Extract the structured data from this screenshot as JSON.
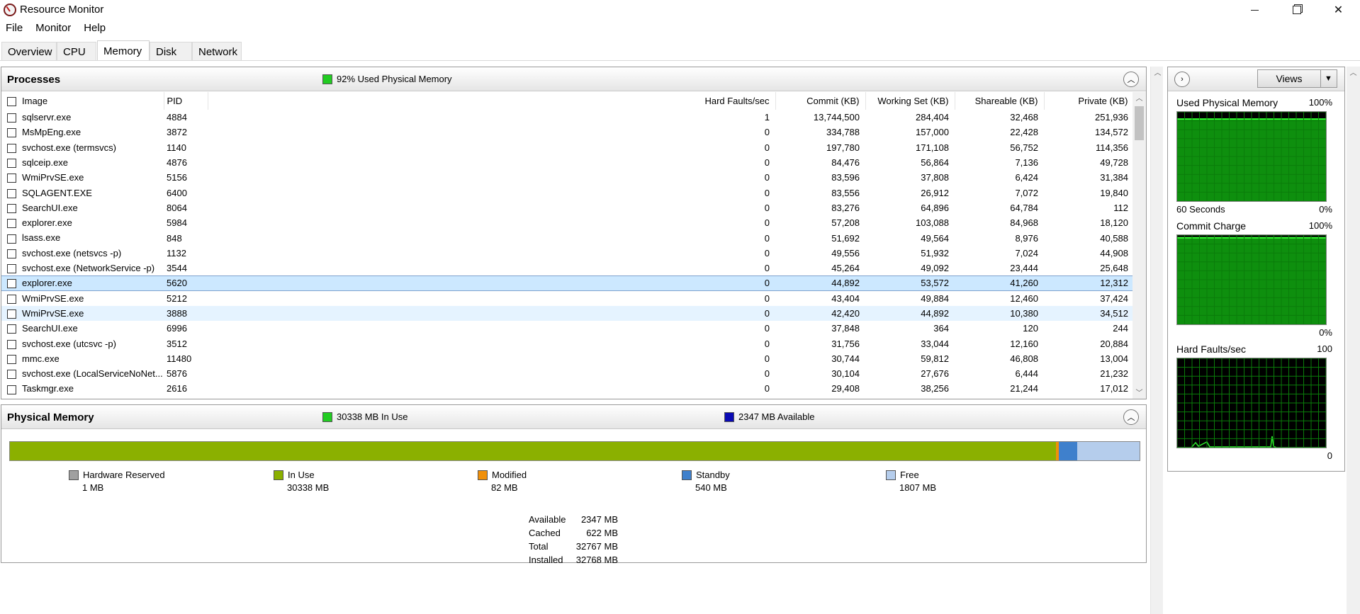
{
  "window": {
    "title": "Resource Monitor"
  },
  "menu": [
    "File",
    "Monitor",
    "Help"
  ],
  "tabs": [
    "Overview",
    "CPU",
    "Memory",
    "Disk",
    "Network"
  ],
  "active_tab": "Memory",
  "processes": {
    "title": "Processes",
    "summary": "92% Used Physical Memory",
    "summary_color": "#22cc22",
    "columns": [
      "Image",
      "PID",
      "Hard Faults/sec",
      "Commit (KB)",
      "Working Set (KB)",
      "Shareable (KB)",
      "Private (KB)"
    ],
    "rows": [
      {
        "image": "sqlservr.exe",
        "pid": "4884",
        "hf": "1",
        "commit": "13,744,500",
        "ws": "284,404",
        "share": "32,468",
        "priv": "251,936"
      },
      {
        "image": "MsMpEng.exe",
        "pid": "3872",
        "hf": "0",
        "commit": "334,788",
        "ws": "157,000",
        "share": "22,428",
        "priv": "134,572"
      },
      {
        "image": "svchost.exe (termsvcs)",
        "pid": "1140",
        "hf": "0",
        "commit": "197,780",
        "ws": "171,108",
        "share": "56,752",
        "priv": "114,356"
      },
      {
        "image": "sqlceip.exe",
        "pid": "4876",
        "hf": "0",
        "commit": "84,476",
        "ws": "56,864",
        "share": "7,136",
        "priv": "49,728"
      },
      {
        "image": "WmiPrvSE.exe",
        "pid": "5156",
        "hf": "0",
        "commit": "83,596",
        "ws": "37,808",
        "share": "6,424",
        "priv": "31,384"
      },
      {
        "image": "SQLAGENT.EXE",
        "pid": "6400",
        "hf": "0",
        "commit": "83,556",
        "ws": "26,912",
        "share": "7,072",
        "priv": "19,840"
      },
      {
        "image": "SearchUI.exe",
        "pid": "8064",
        "hf": "0",
        "commit": "83,276",
        "ws": "64,896",
        "share": "64,784",
        "priv": "112"
      },
      {
        "image": "explorer.exe",
        "pid": "5984",
        "hf": "0",
        "commit": "57,208",
        "ws": "103,088",
        "share": "84,968",
        "priv": "18,120"
      },
      {
        "image": "lsass.exe",
        "pid": "848",
        "hf": "0",
        "commit": "51,692",
        "ws": "49,564",
        "share": "8,976",
        "priv": "40,588"
      },
      {
        "image": "svchost.exe (netsvcs -p)",
        "pid": "1132",
        "hf": "0",
        "commit": "49,556",
        "ws": "51,932",
        "share": "7,024",
        "priv": "44,908"
      },
      {
        "image": "svchost.exe (NetworkService -p)",
        "pid": "3544",
        "hf": "0",
        "commit": "45,264",
        "ws": "49,092",
        "share": "23,444",
        "priv": "25,648"
      },
      {
        "image": "explorer.exe",
        "pid": "5620",
        "hf": "0",
        "commit": "44,892",
        "ws": "53,572",
        "share": "41,260",
        "priv": "12,312"
      },
      {
        "image": "WmiPrvSE.exe",
        "pid": "5212",
        "hf": "0",
        "commit": "43,404",
        "ws": "49,884",
        "share": "12,460",
        "priv": "37,424"
      },
      {
        "image": "WmiPrvSE.exe",
        "pid": "3888",
        "hf": "0",
        "commit": "42,420",
        "ws": "44,892",
        "share": "10,380",
        "priv": "34,512"
      },
      {
        "image": "SearchUI.exe",
        "pid": "6996",
        "hf": "0",
        "commit": "37,848",
        "ws": "364",
        "share": "120",
        "priv": "244"
      },
      {
        "image": "svchost.exe (utcsvc -p)",
        "pid": "3512",
        "hf": "0",
        "commit": "31,756",
        "ws": "33,044",
        "share": "12,160",
        "priv": "20,884"
      },
      {
        "image": "mmc.exe",
        "pid": "11480",
        "hf": "0",
        "commit": "30,744",
        "ws": "59,812",
        "share": "46,808",
        "priv": "13,004"
      },
      {
        "image": "svchost.exe (LocalServiceNoNet...",
        "pid": "5876",
        "hf": "0",
        "commit": "30,104",
        "ws": "27,676",
        "share": "6,444",
        "priv": "21,232"
      },
      {
        "image": "Taskmgr.exe",
        "pid": "2616",
        "hf": "0",
        "commit": "29,408",
        "ws": "38,256",
        "share": "21,244",
        "priv": "17,012"
      }
    ]
  },
  "physical_memory": {
    "title": "Physical Memory",
    "in_use_summary": "30338 MB In Use",
    "in_use_color": "#22cc22",
    "available_summary": "2347 MB Available",
    "available_color": "#0a0ab4",
    "bar": {
      "hardware_reserved_mb": 1,
      "in_use_mb": 30338,
      "modified_mb": 82,
      "standby_mb": 540,
      "free_mb": 1807
    },
    "legend": [
      {
        "name": "Hardware Reserved",
        "value": "1 MB",
        "color": "#a0a0a0"
      },
      {
        "name": "In Use",
        "value": "30338 MB",
        "color": "#8bb000"
      },
      {
        "name": "Modified",
        "value": "82 MB",
        "color": "#f0900a"
      },
      {
        "name": "Standby",
        "value": "540 MB",
        "color": "#3f80cc"
      },
      {
        "name": "Free",
        "value": "1807 MB",
        "color": "#b5cdec"
      }
    ],
    "summary": [
      {
        "k": "Available",
        "v": "2347 MB"
      },
      {
        "k": "Cached",
        "v": "622 MB"
      },
      {
        "k": "Total",
        "v": "32767 MB"
      },
      {
        "k": "Installed",
        "v": "32768 MB"
      }
    ]
  },
  "graphs": {
    "views_label": "Views",
    "items": [
      {
        "title": "Used Physical Memory",
        "max": "100%",
        "foot_left": "60 Seconds",
        "foot_right": "0%",
        "fill_fraction": 0.92
      },
      {
        "title": "Commit Charge",
        "max": "100%",
        "foot_left": "",
        "foot_right": "0%",
        "fill_fraction": 0.97
      },
      {
        "title": "Hard Faults/sec",
        "max": "100",
        "foot_left": "",
        "foot_right": "0",
        "fill_fraction": 0
      }
    ]
  }
}
